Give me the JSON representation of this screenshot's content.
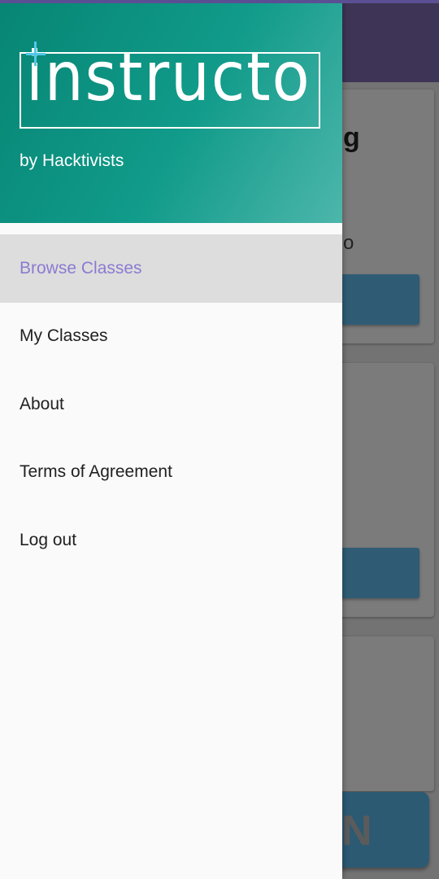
{
  "colors": {
    "header_gradient_start": "#078574",
    "header_gradient_end": "#4db6ab",
    "active_item_text": "#8b7bd1",
    "active_item_bg": "#dddddd",
    "toolbar": "#3e3556",
    "logo_plus_accent": "#52c8e8"
  },
  "drawer": {
    "logo_text": "instructo",
    "subtitle": "by Hacktivists",
    "menu": [
      {
        "label": "Browse Classes",
        "active": true
      },
      {
        "label": "My Classes",
        "active": false
      },
      {
        "label": "About",
        "active": false
      },
      {
        "label": "Terms of Agreement",
        "active": false
      },
      {
        "label": "Log out",
        "active": false
      }
    ]
  },
  "background": {
    "card_title_partial": "g",
    "card_sub_partial": "o",
    "fab_label_partial": "N"
  }
}
